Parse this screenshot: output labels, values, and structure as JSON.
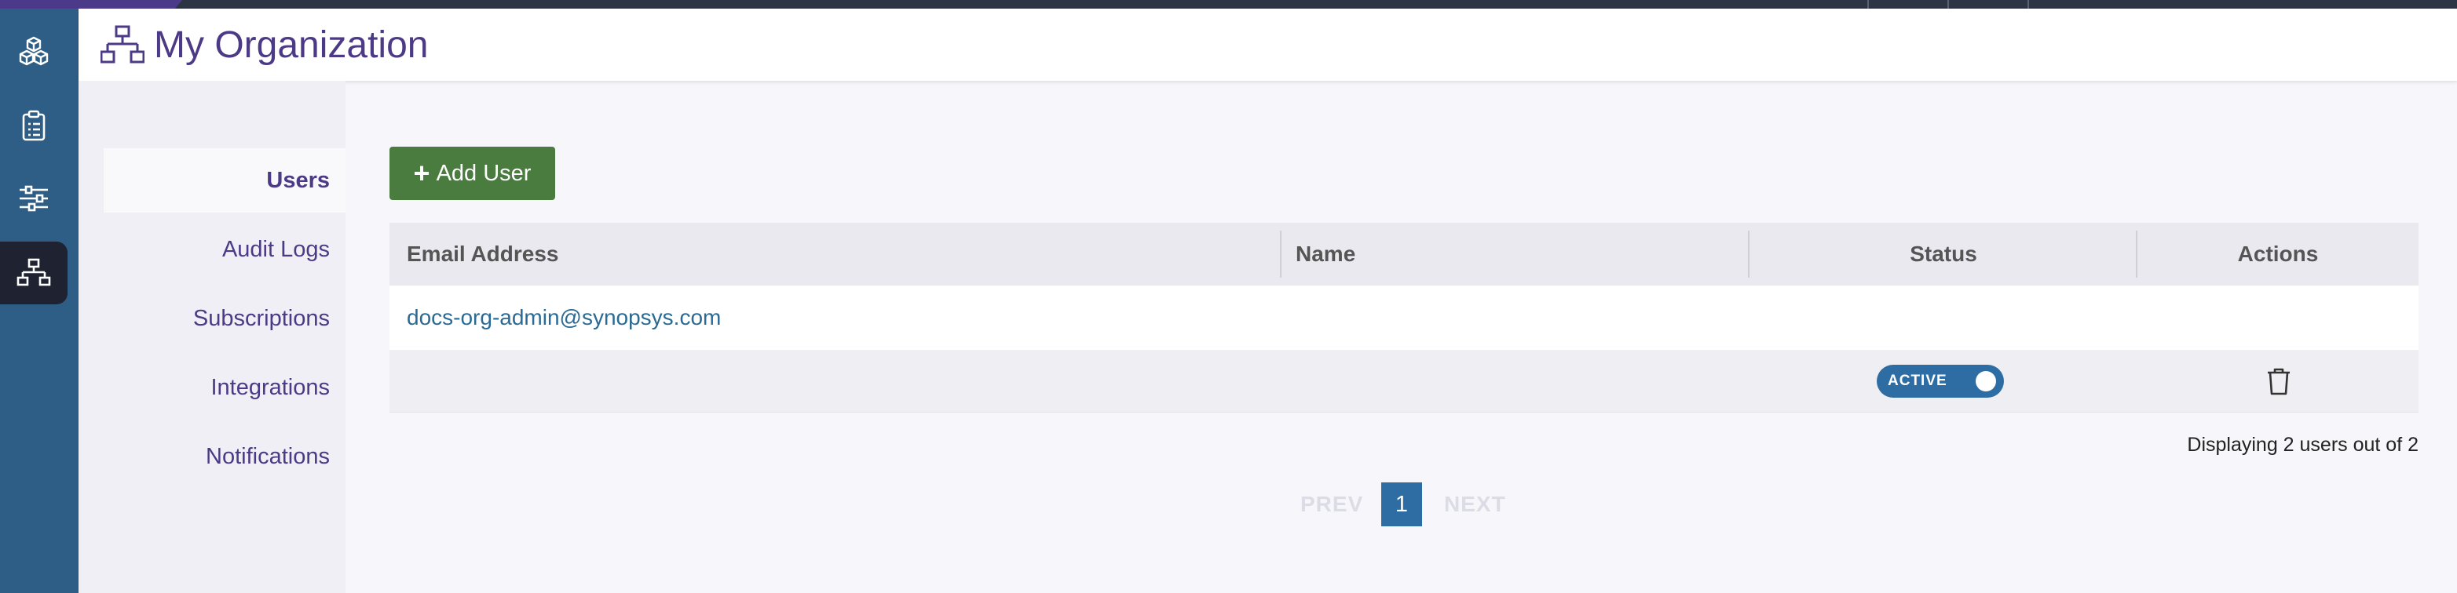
{
  "colors": {
    "rail": "#2e5d86",
    "rail_active": "#1f2230",
    "title": "#4c3a86",
    "add_button": "#4a7c3f",
    "link": "#2a6a94",
    "toggle": "#2e6da4"
  },
  "rail": {
    "items": [
      {
        "icon": "cubes-icon"
      },
      {
        "icon": "clipboard-icon"
      },
      {
        "icon": "sliders-icon"
      },
      {
        "icon": "org-chart-icon",
        "active": true
      }
    ]
  },
  "header": {
    "icon": "org-chart-icon",
    "title": "My Organization"
  },
  "subnav": {
    "items": [
      {
        "label": "Users",
        "active": true
      },
      {
        "label": "Audit Logs"
      },
      {
        "label": "Subscriptions"
      },
      {
        "label": "Integrations"
      },
      {
        "label": "Notifications"
      }
    ]
  },
  "main": {
    "add_button_label": "Add User",
    "table": {
      "columns": [
        "Email Address",
        "Name",
        "Status",
        "Actions"
      ],
      "rows": [
        {
          "email": "docs-org-admin@synopsys.com",
          "name": "",
          "status": "ACTIVE",
          "status_on": true,
          "action_icon": "trash-icon"
        }
      ]
    },
    "summary": "Displaying 2 users out of 2",
    "pagination": {
      "prev": "PREV",
      "current": "1",
      "next": "NEXT"
    }
  }
}
